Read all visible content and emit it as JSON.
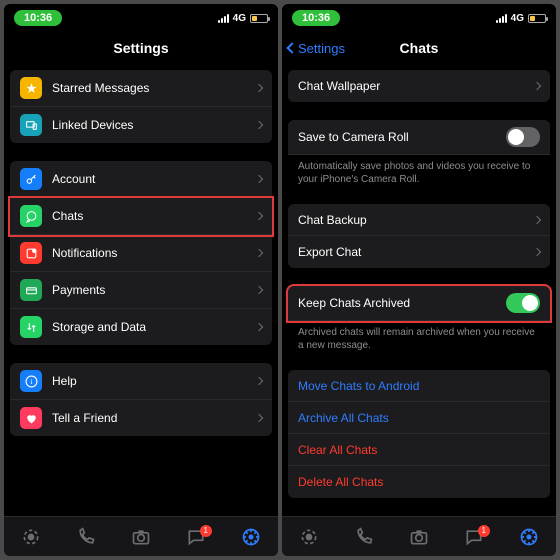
{
  "status": {
    "time": "10:36",
    "network": "4G"
  },
  "left": {
    "title": "Settings",
    "group1": [
      {
        "label": "Starred Messages"
      },
      {
        "label": "Linked Devices"
      }
    ],
    "group2": [
      {
        "label": "Account"
      },
      {
        "label": "Chats"
      },
      {
        "label": "Notifications"
      },
      {
        "label": "Payments"
      },
      {
        "label": "Storage and Data"
      }
    ],
    "group3": [
      {
        "label": "Help"
      },
      {
        "label": "Tell a Friend"
      }
    ]
  },
  "right": {
    "back": "Settings",
    "title": "Chats",
    "wallpaper": "Chat Wallpaper",
    "save_label": "Save to Camera Roll",
    "save_note": "Automatically save photos and videos you receive to your iPhone's Camera Roll.",
    "backup": "Chat Backup",
    "export": "Export Chat",
    "keep_label": "Keep Chats Archived",
    "keep_note": "Archived chats will remain archived when you receive a new message.",
    "move": "Move Chats to Android",
    "archive_all": "Archive All Chats",
    "clear_all": "Clear All Chats",
    "delete_all": "Delete All Chats"
  },
  "tabs": {
    "chat_badge": "1"
  },
  "colors": {
    "icon_yellow": "#f7b500",
    "icon_teal": "#17a2b8",
    "icon_blue": "#157efb",
    "icon_green": "#25d366",
    "icon_red": "#ff3b30",
    "highlight": "#e03a3a"
  }
}
